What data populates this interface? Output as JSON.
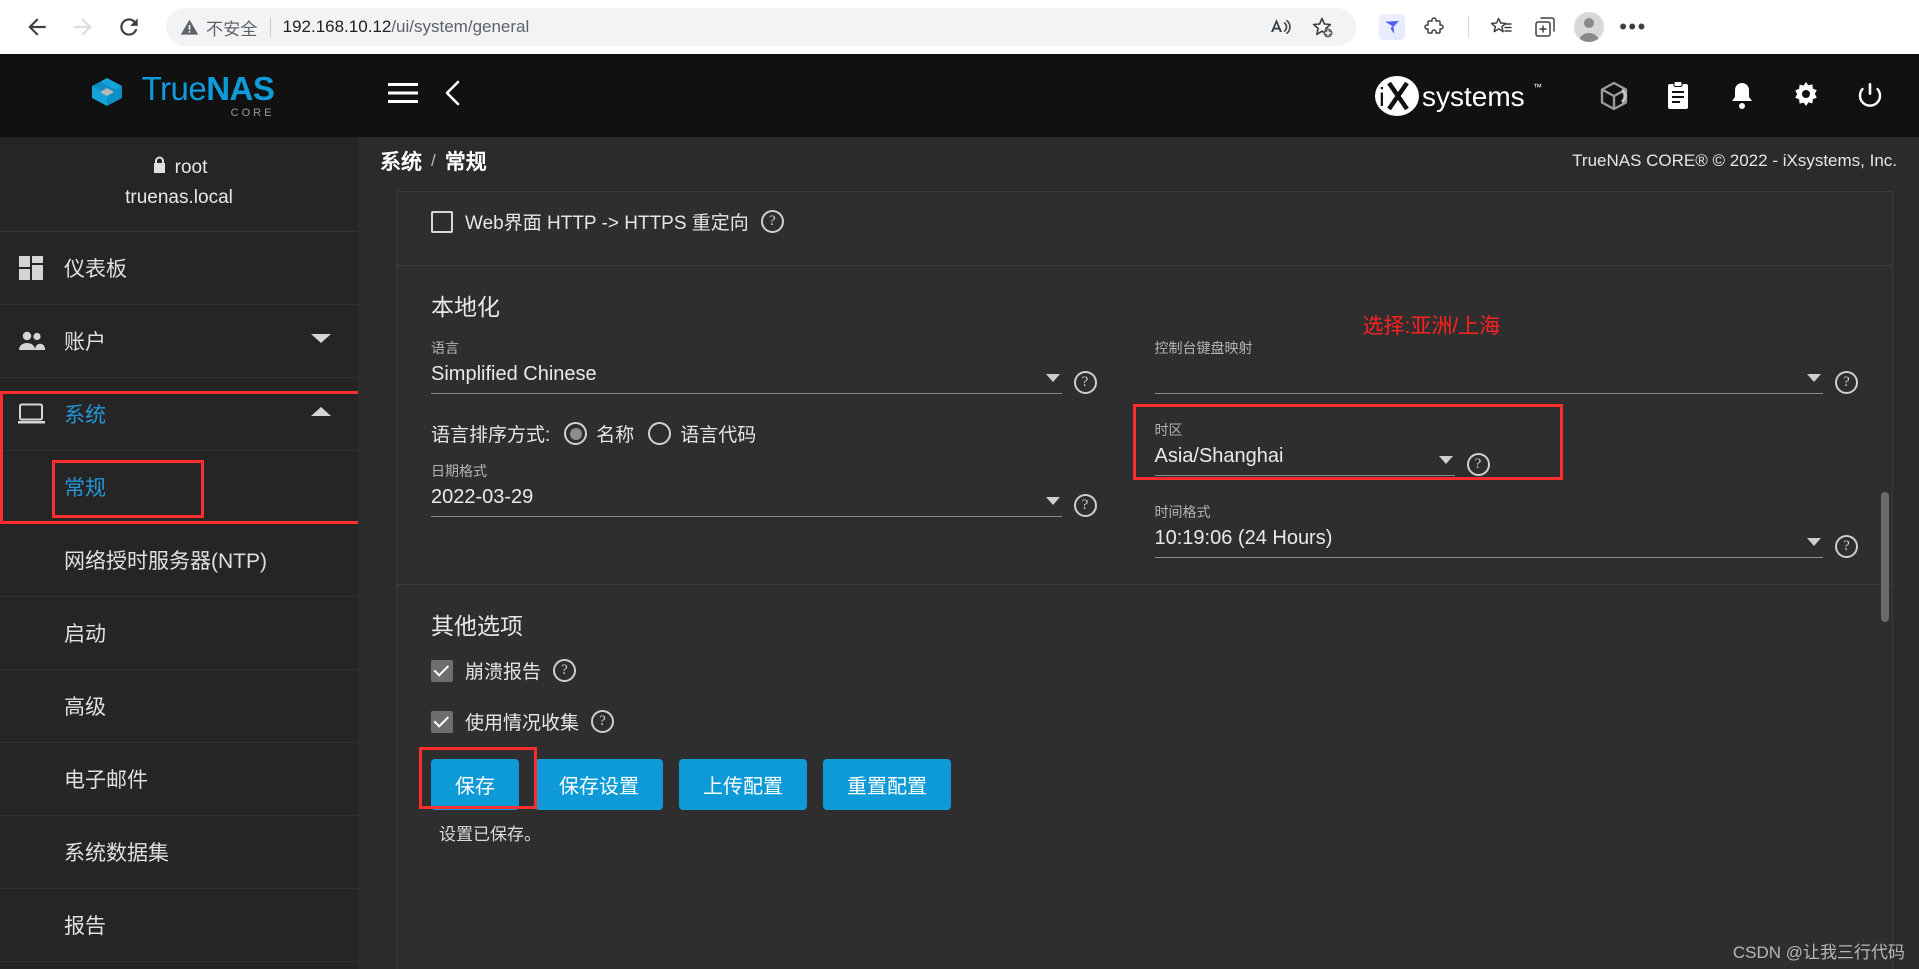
{
  "browser": {
    "back_icon": "back-arrow-icon",
    "forward_icon": "forward-arrow-icon",
    "reload_icon": "reload-icon",
    "security_label": "不安全",
    "url_host": "192.168.10.12",
    "url_path": "/ui/system/general",
    "toolbar_icons": [
      "read-aloud-icon",
      "add-favorite-icon",
      "extension-app-icon",
      "extensions-puzzle-icon",
      "favorites-list-icon",
      "split-screen-icon",
      "profile-avatar-icon",
      "more-settings-icon"
    ]
  },
  "brand": {
    "name_true": "True",
    "name_nas": "NAS",
    "edition": "CORE",
    "vendor": "iXsystems",
    "vendor_tm": "™"
  },
  "topbar": {
    "menu_icon": "hamburger-menu-icon",
    "collapse_icon": "chevron-left-icon",
    "icons": [
      "truecommand-cube-icon",
      "tasks-clipboard-icon",
      "alerts-bell-icon",
      "settings-gear-icon",
      "power-icon"
    ]
  },
  "breadcrumb": {
    "parent": "系统",
    "separator": "/",
    "current": "常规",
    "copyright": "TrueNAS CORE® © 2022 - iXsystems, Inc."
  },
  "sidebar": {
    "lock_icon": "lock-icon",
    "user": "root",
    "hostname": "truenas.local",
    "items": [
      {
        "label": "仪表板",
        "icon": "dashboard-grid-icon",
        "active": false,
        "expandable": false
      },
      {
        "label": "账户",
        "icon": "accounts-people-icon",
        "active": false,
        "expandable": true,
        "caret": "chevron-down-icon"
      },
      {
        "label": "系统",
        "icon": "system-monitor-icon",
        "active": true,
        "expandable": true,
        "caret": "chevron-up-icon"
      }
    ],
    "sub_items": [
      {
        "label": "常规",
        "active": true
      },
      {
        "label": "网络授时服务器(NTP)",
        "active": false
      },
      {
        "label": "启动",
        "active": false
      },
      {
        "label": "高级",
        "active": false
      },
      {
        "label": "电子邮件",
        "active": false
      },
      {
        "label": "系统数据集",
        "active": false
      },
      {
        "label": "报告",
        "active": false
      }
    ]
  },
  "form": {
    "http_redirect": {
      "label": "Web界面 HTTP -> HTTPS 重定向",
      "checked": false,
      "help_icon": "help-circle-icon"
    },
    "localization_title": "本地化",
    "language": {
      "label": "语言",
      "value": "Simplified Chinese",
      "help_icon": "help-circle-icon",
      "arrow_icon": "chevron-down-icon"
    },
    "console_keymap": {
      "label": "控制台键盘映射",
      "value": "",
      "help_icon": "help-circle-icon",
      "arrow_icon": "chevron-down-icon"
    },
    "sort_language_by": {
      "label": "语言排序方式:",
      "option_name": "名称",
      "option_code": "语言代码",
      "selected": "名称"
    },
    "timezone": {
      "label": "时区",
      "value": "Asia/Shanghai",
      "help_icon": "help-circle-icon",
      "arrow_icon": "chevron-down-icon",
      "highlighted": true
    },
    "date_format": {
      "label": "日期格式",
      "value": "2022-03-29",
      "help_icon": "help-circle-icon",
      "arrow_icon": "chevron-down-icon"
    },
    "time_format": {
      "label": "时间格式",
      "value": "10:19:06 (24 Hours)",
      "help_icon": "help-circle-icon",
      "arrow_icon": "chevron-down-icon"
    },
    "other_options_title": "其他选项",
    "crash_reporting": {
      "label": "崩溃报告",
      "checked": true,
      "help_icon": "help-circle-icon"
    },
    "usage_collection": {
      "label": "使用情况收集",
      "checked": true,
      "help_icon": "help-circle-icon"
    },
    "buttons": {
      "save": "保存",
      "save_config": "保存设置",
      "upload_config": "上传配置",
      "reset_config": "重置配置"
    },
    "saved_note": "设置已保存。"
  },
  "annotations": {
    "timezone_hint": "选择:亚洲/上海",
    "highlight_color": "#ff2d2d"
  },
  "watermark": "CSDN @让我三行代码"
}
